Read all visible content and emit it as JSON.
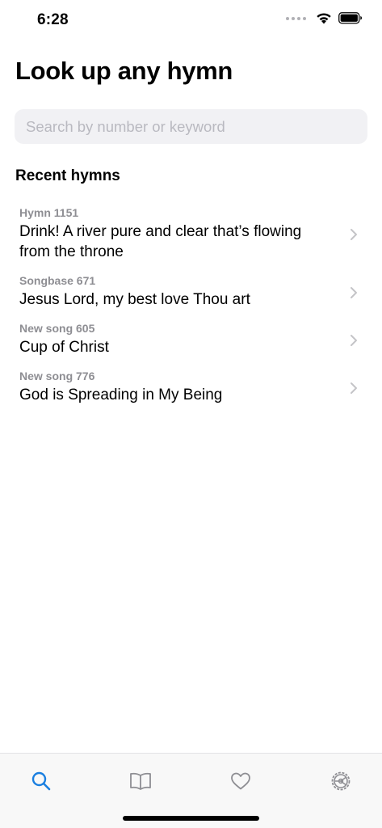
{
  "status_bar": {
    "time": "6:28"
  },
  "page_title": "Look up any hymn",
  "search": {
    "placeholder": "Search by number or keyword",
    "value": ""
  },
  "recent": {
    "heading": "Recent hymns",
    "items": [
      {
        "number": "Hymn 1151",
        "title": "Drink! A river pure and clear that’s flowing from the throne"
      },
      {
        "number": "Songbase 671",
        "title": "Jesus Lord, my best love Thou art"
      },
      {
        "number": "New song 605",
        "title": "Cup of Christ"
      },
      {
        "number": "New song 776",
        "title": "God is Spreading in My Being"
      }
    ]
  },
  "tab_bar": {
    "tabs": [
      {
        "icon": "search-icon",
        "active": true
      },
      {
        "icon": "book-icon",
        "active": false
      },
      {
        "icon": "heart-icon",
        "active": false
      },
      {
        "icon": "gear-icon",
        "active": false
      }
    ]
  },
  "colors": {
    "accent": "#1a7fe0",
    "inactive_icon": "#8e8e93",
    "secondary_text": "#8e8e93"
  }
}
